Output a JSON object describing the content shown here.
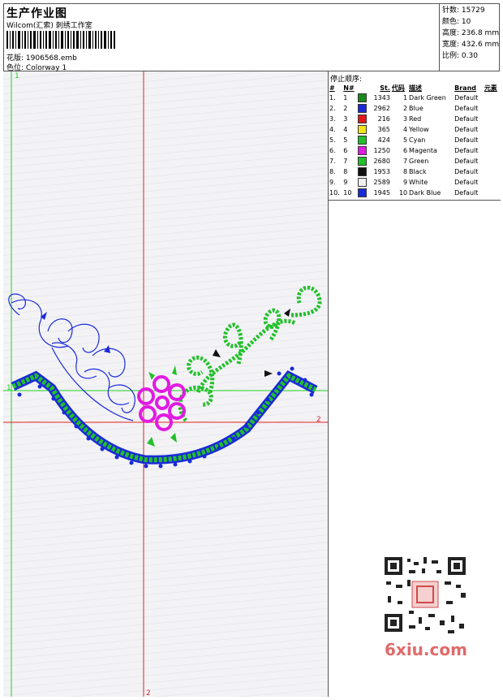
{
  "header": {
    "title": "生产作业图",
    "subtitle": "Wilcom(汇索) 刺绣工作室",
    "design_label": "花版:",
    "design_value": "1906568.emb",
    "colorway_label": "色位:",
    "colorway_value": "Colorway 1"
  },
  "stats": [
    {
      "label": "针数:",
      "value": "15729"
    },
    {
      "label": "颜色:",
      "value": "10"
    },
    {
      "label": "高度:",
      "value": "236.8 mm"
    },
    {
      "label": "宽度:",
      "value": "432.6 mm"
    },
    {
      "label": "比例:",
      "value": "0.30"
    }
  ],
  "stop_sequence": {
    "title": "停止顺序:",
    "columns": [
      "#",
      "N#",
      "St.",
      "代码",
      "描述",
      "Brand",
      "元素"
    ],
    "rows": [
      {
        "num": "1.",
        "n": "1",
        "color": "#1a8a1a",
        "st": "1343",
        "code": "1",
        "desc": "Dark Green",
        "brand": "Default"
      },
      {
        "num": "2.",
        "n": "2",
        "color": "#1a2ad8",
        "st": "2962",
        "code": "2",
        "desc": "Blue",
        "brand": "Default"
      },
      {
        "num": "3.",
        "n": "3",
        "color": "#e21818",
        "st": "216",
        "code": "3",
        "desc": "Red",
        "brand": "Default"
      },
      {
        "num": "4.",
        "n": "4",
        "color": "#f2e41a",
        "st": "365",
        "code": "4",
        "desc": "Yellow",
        "brand": "Default"
      },
      {
        "num": "5.",
        "n": "5",
        "color": "#22c02a",
        "st": "424",
        "code": "5",
        "desc": "Cyan",
        "brand": "Default"
      },
      {
        "num": "6.",
        "n": "6",
        "color": "#e21ae2",
        "st": "1250",
        "code": "6",
        "desc": "Magenta",
        "brand": "Default"
      },
      {
        "num": "7.",
        "n": "7",
        "color": "#22c02a",
        "st": "2680",
        "code": "7",
        "desc": "Green",
        "brand": "Default"
      },
      {
        "num": "8.",
        "n": "8",
        "color": "#111111",
        "st": "1953",
        "code": "8",
        "desc": "Black",
        "brand": "Default"
      },
      {
        "num": "9.",
        "n": "9",
        "color": "#f0f0f0",
        "st": "2589",
        "code": "9",
        "desc": "White",
        "brand": "Default"
      },
      {
        "num": "10.",
        "n": "10",
        "color": "#1a2ad8",
        "st": "1945",
        "code": "10",
        "desc": "Dark Blue",
        "brand": "Default"
      }
    ]
  },
  "guide_labels": {
    "top_left": "1",
    "left_mid": "1",
    "right_mid": "2",
    "bottom": "2"
  },
  "watermark": "6xiu.com",
  "colors": {
    "guide_red": "#e02020",
    "guide_green": "#20d020",
    "embroidery_blue": "#1a2ad8",
    "embroidery_green": "#22c02a",
    "embroidery_magenta": "#e21ae2"
  }
}
